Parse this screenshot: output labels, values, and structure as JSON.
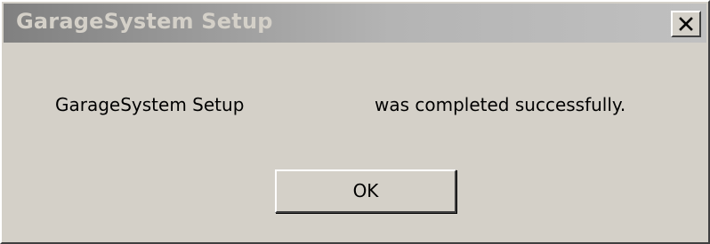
{
  "window": {
    "title": "GarageSystem Setup",
    "close_icon": "close-icon"
  },
  "message": {
    "app_name": "GarageSystem Setup",
    "text": "was completed successfully."
  },
  "buttons": {
    "ok_label": "OK"
  }
}
